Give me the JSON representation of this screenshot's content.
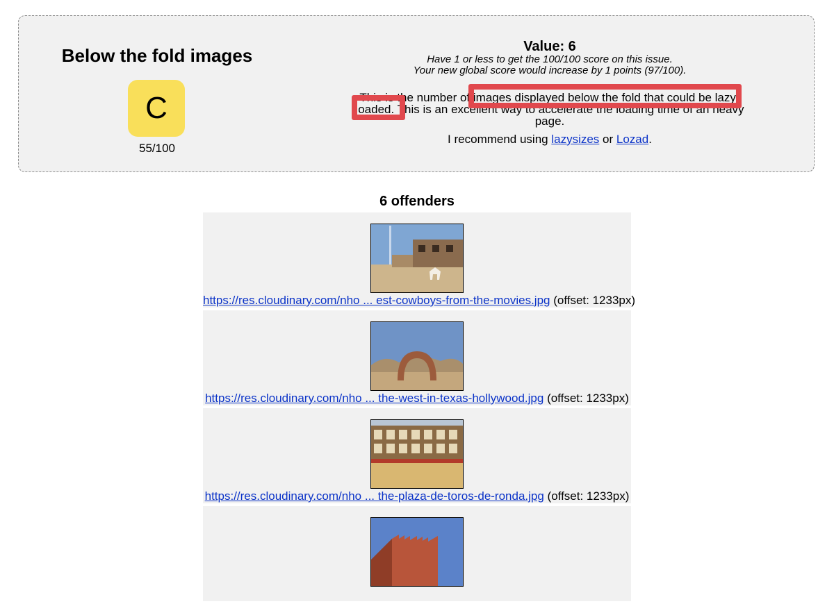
{
  "rule": {
    "title": "Below the fold images",
    "grade": "C",
    "score": "55/100",
    "value": "Value: 6",
    "hint_1": "Have 1 or less to get the 100/100 score on this issue.",
    "hint_2": "Your new global score would increase by 1 points (97/100).",
    "description": "This is the number of images displayed below the fold that could be lazy-loaded. This is an excellent way to accelerate the loading time of an heavy page.",
    "recommend_prefix": "I recommend using ",
    "link_1": "lazysizes",
    "recommend_mid": " or ",
    "link_2": "Lozad",
    "recommend_suffix": "."
  },
  "offenders": {
    "title": "6 offenders",
    "items": [
      {
        "url": "https://res.cloudinary.com/nho ... est-cowboys-from-the-movies.jpg",
        "offset": " (offset: 1233px)",
        "image": "western-town-street-photo"
      },
      {
        "url": "https://res.cloudinary.com/nho ... the-west-in-texas-hollywood.jpg",
        "offset": " (offset: 1233px)",
        "image": "stone-arch-desert-photo"
      },
      {
        "url": "https://res.cloudinary.com/nho ... the-plaza-de-toros-de-ronda.jpg",
        "offset": " (offset: 1233px)",
        "image": "bullring-arena-photo"
      },
      {
        "url": "",
        "offset": "",
        "image": "red-fortress-tower-photo"
      }
    ]
  },
  "colors": {
    "grade_badge": "#f9df5a",
    "highlight": "#e1484d",
    "link": "#0b33c8",
    "panel_bg": "#f1f1f1"
  }
}
